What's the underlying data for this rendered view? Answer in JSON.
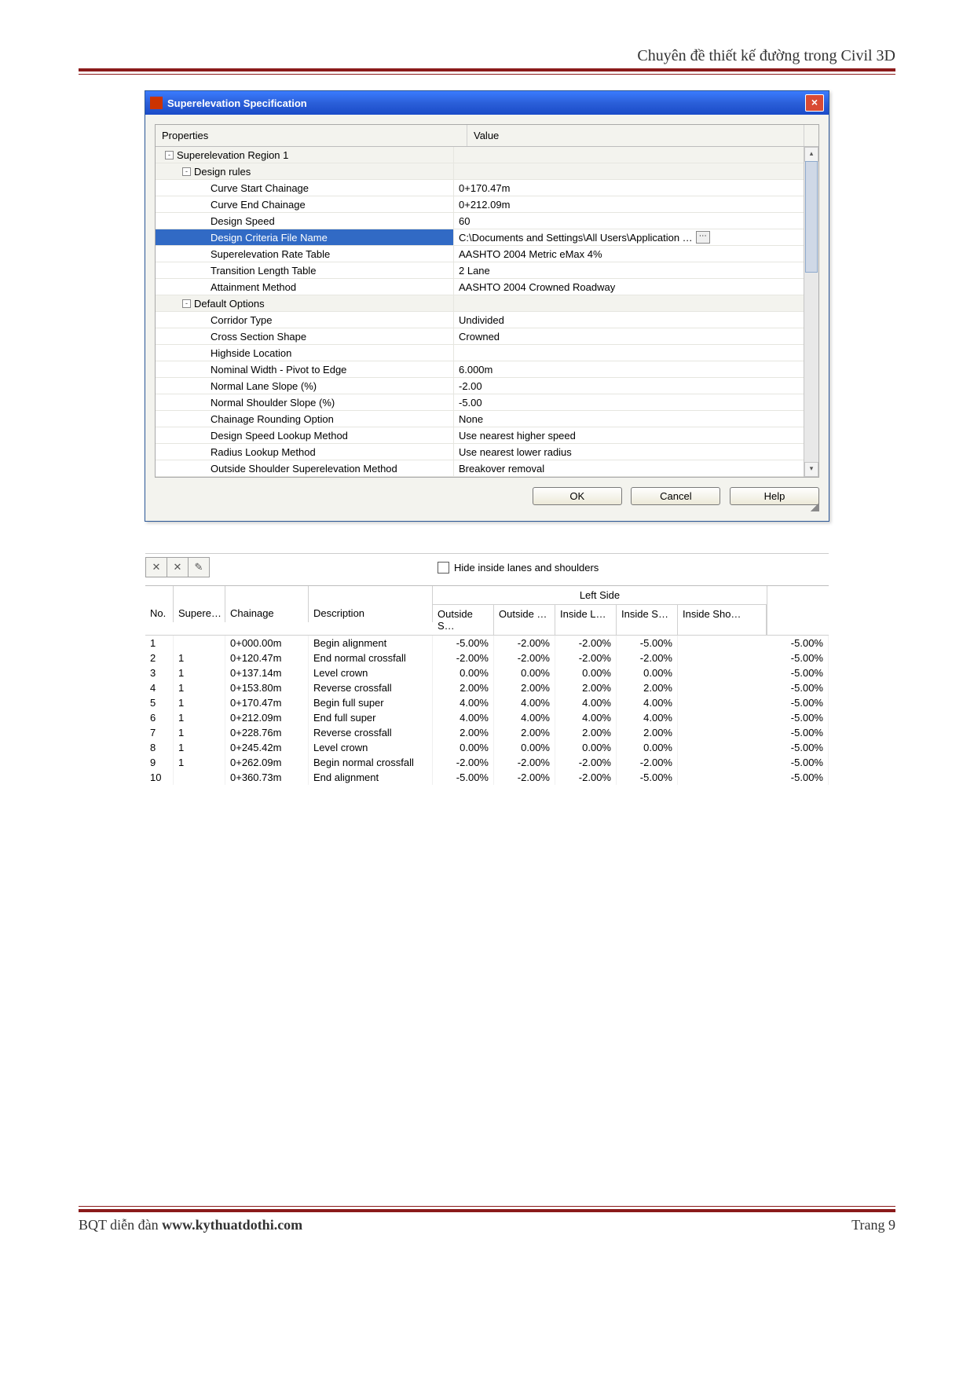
{
  "page": {
    "header_title": "Chuyên đề thiết kế đường trong Civil 3D",
    "footer_left_prefix": "BQT diễn đàn ",
    "footer_left_bold": "www.kythuatdothi.com",
    "footer_right": "Trang 9"
  },
  "dialog": {
    "title": "Superelevation Specification",
    "col_prop": "Properties",
    "col_val": "Value",
    "rows": [
      {
        "lvl": 0,
        "type": "cat",
        "exp": "-",
        "label": "Superelevation Region 1",
        "value": ""
      },
      {
        "lvl": 1,
        "type": "cat",
        "exp": "-",
        "label": "Design rules",
        "value": ""
      },
      {
        "lvl": 2,
        "type": "item",
        "label": "Curve Start Chainage",
        "value": "0+170.47m"
      },
      {
        "lvl": 2,
        "type": "item",
        "label": "Curve End Chainage",
        "value": "0+212.09m"
      },
      {
        "lvl": 2,
        "type": "item",
        "label": "Design Speed",
        "value": "60"
      },
      {
        "lvl": 2,
        "type": "item",
        "label": "Design Criteria File Name",
        "value": "C:\\Documents and Settings\\All Users\\Application …",
        "selected": true,
        "ellipsis": true
      },
      {
        "lvl": 2,
        "type": "item",
        "label": "Superelevation Rate Table",
        "value": "AASHTO 2004 Metric eMax 4%"
      },
      {
        "lvl": 2,
        "type": "item",
        "label": "Transition Length Table",
        "value": "2 Lane"
      },
      {
        "lvl": 2,
        "type": "item",
        "label": "Attainment Method",
        "value": "AASHTO 2004 Crowned Roadway"
      },
      {
        "lvl": 1,
        "type": "cat",
        "exp": "-",
        "label": "Default Options",
        "value": ""
      },
      {
        "lvl": 2,
        "type": "item",
        "label": "Corridor Type",
        "value": "Undivided"
      },
      {
        "lvl": 2,
        "type": "item",
        "label": "Cross Section Shape",
        "value": "Crowned"
      },
      {
        "lvl": 2,
        "type": "item",
        "label": "Highside Location",
        "value": ""
      },
      {
        "lvl": 2,
        "type": "item",
        "label": "Nominal Width - Pivot to Edge",
        "value": "6.000m"
      },
      {
        "lvl": 2,
        "type": "item",
        "label": "Normal Lane Slope (%)",
        "value": "-2.00"
      },
      {
        "lvl": 2,
        "type": "item",
        "label": "Normal Shoulder Slope (%)",
        "value": "-5.00"
      },
      {
        "lvl": 2,
        "type": "item",
        "label": "Chainage Rounding Option",
        "value": "None"
      },
      {
        "lvl": 2,
        "type": "item",
        "label": "Design Speed Lookup Method",
        "value": "Use nearest higher speed"
      },
      {
        "lvl": 2,
        "type": "item",
        "label": "Radius Lookup Method",
        "value": "Use nearest lower radius"
      },
      {
        "lvl": 2,
        "type": "item",
        "label": "Outside Shoulder Superelevation Method",
        "value": "Breakover removal"
      }
    ],
    "buttons": {
      "ok": "OK",
      "cancel": "Cancel",
      "help": "Help"
    }
  },
  "panel2": {
    "hide_label": "Hide inside lanes and shoulders",
    "headers": {
      "no": "No.",
      "supere": "Supere…",
      "chainage": "Chainage",
      "description": "Description",
      "leftside": "Left Side",
      "sub": [
        "Outside S…",
        "Outside …",
        "Inside L…",
        "Inside S…",
        "Inside Sho…"
      ]
    },
    "rows": [
      {
        "no": "1",
        "sup": "",
        "ch": "0+000.00m",
        "desc": "Begin alignment",
        "v": [
          "-5.00%",
          "-2.00%",
          "-2.00%",
          "-5.00%",
          "-5.00%"
        ]
      },
      {
        "no": "2",
        "sup": "1",
        "ch": "0+120.47m",
        "desc": "End normal crossfall",
        "v": [
          "-2.00%",
          "-2.00%",
          "-2.00%",
          "-2.00%",
          "-5.00%"
        ]
      },
      {
        "no": "3",
        "sup": "1",
        "ch": "0+137.14m",
        "desc": "Level crown",
        "v": [
          "0.00%",
          "0.00%",
          "0.00%",
          "0.00%",
          "-5.00%"
        ]
      },
      {
        "no": "4",
        "sup": "1",
        "ch": "0+153.80m",
        "desc": "Reverse crossfall",
        "v": [
          "2.00%",
          "2.00%",
          "2.00%",
          "2.00%",
          "-5.00%"
        ]
      },
      {
        "no": "5",
        "sup": "1",
        "ch": "0+170.47m",
        "desc": "Begin full super",
        "v": [
          "4.00%",
          "4.00%",
          "4.00%",
          "4.00%",
          "-5.00%"
        ]
      },
      {
        "no": "6",
        "sup": "1",
        "ch": "0+212.09m",
        "desc": "End full super",
        "v": [
          "4.00%",
          "4.00%",
          "4.00%",
          "4.00%",
          "-5.00%"
        ]
      },
      {
        "no": "7",
        "sup": "1",
        "ch": "0+228.76m",
        "desc": "Reverse crossfall",
        "v": [
          "2.00%",
          "2.00%",
          "2.00%",
          "2.00%",
          "-5.00%"
        ]
      },
      {
        "no": "8",
        "sup": "1",
        "ch": "0+245.42m",
        "desc": "Level crown",
        "v": [
          "0.00%",
          "0.00%",
          "0.00%",
          "0.00%",
          "-5.00%"
        ]
      },
      {
        "no": "9",
        "sup": "1",
        "ch": "0+262.09m",
        "desc": "Begin normal crossfall",
        "v": [
          "-2.00%",
          "-2.00%",
          "-2.00%",
          "-2.00%",
          "-5.00%"
        ]
      },
      {
        "no": "10",
        "sup": "",
        "ch": "0+360.73m",
        "desc": "End alignment",
        "v": [
          "-5.00%",
          "-2.00%",
          "-2.00%",
          "-5.00%",
          "-5.00%"
        ]
      }
    ]
  }
}
